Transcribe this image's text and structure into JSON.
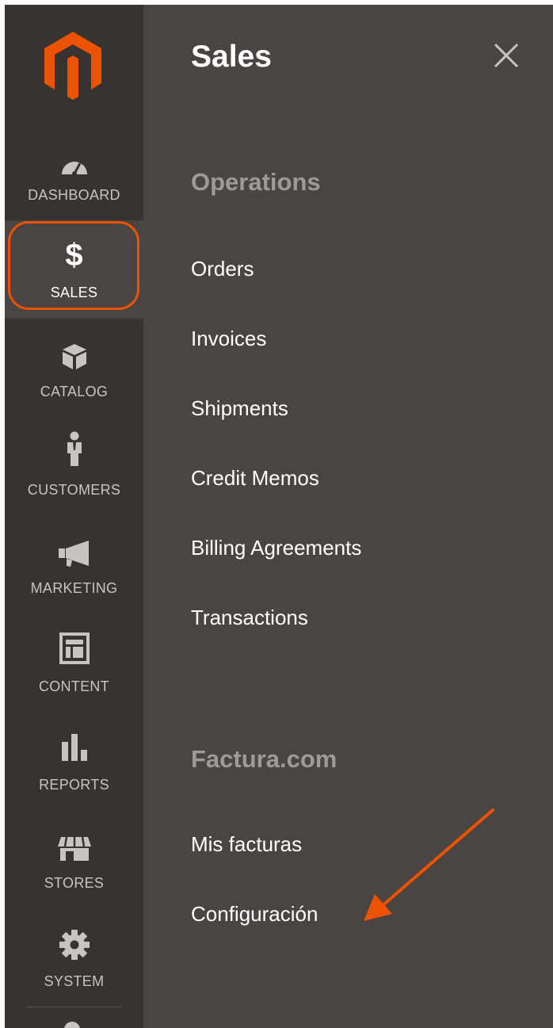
{
  "rail": {
    "items": [
      {
        "label": "DASHBOARD",
        "icon": "gauge-icon"
      },
      {
        "label": "SALES",
        "icon": "dollar-icon"
      },
      {
        "label": "CATALOG",
        "icon": "box-icon"
      },
      {
        "label": "CUSTOMERS",
        "icon": "person-icon"
      },
      {
        "label": "MARKETING",
        "icon": "megaphone-icon"
      },
      {
        "label": "CONTENT",
        "icon": "layout-icon"
      },
      {
        "label": "REPORTS",
        "icon": "bar-chart-icon"
      },
      {
        "label": "STORES",
        "icon": "storefront-icon"
      },
      {
        "label": "SYSTEM",
        "icon": "gear-icon"
      }
    ],
    "sales_symbol": "$"
  },
  "panel": {
    "title": "Sales",
    "groups": [
      {
        "title": "Operations",
        "links": [
          "Orders",
          "Invoices",
          "Shipments",
          "Credit Memos",
          "Billing Agreements",
          "Transactions"
        ]
      },
      {
        "title": "Factura.com",
        "links": [
          "Mis facturas",
          "Configuración"
        ]
      }
    ]
  },
  "colors": {
    "rail_bg": "#373330",
    "panel_bg": "#4a4542",
    "brand_orange": "#eb5202",
    "group_title": "#a09a95"
  }
}
